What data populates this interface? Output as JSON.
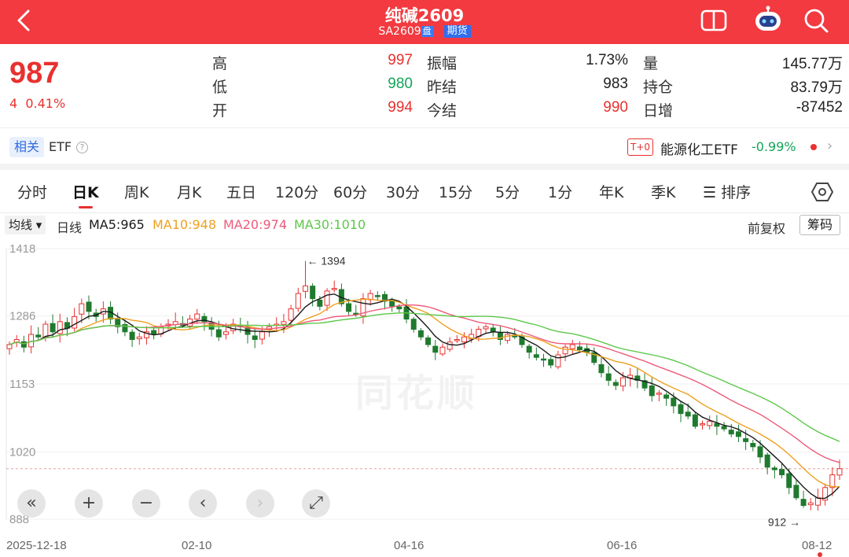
{
  "header": {
    "title": "纯碱2609",
    "code": "SA2609",
    "tag1": "盘",
    "tag2": "期货"
  },
  "quote": {
    "price": "987",
    "change": "4",
    "change_pct": "0.41%",
    "fields": [
      {
        "label": "高",
        "value": "997",
        "color": "red"
      },
      {
        "label": "低",
        "value": "980",
        "color": "green"
      },
      {
        "label": "开",
        "value": "994",
        "color": "red"
      },
      {
        "label": "振幅",
        "value": "1.73%",
        "color": "dark"
      },
      {
        "label": "昨结",
        "value": "983",
        "color": "dark"
      },
      {
        "label": "今结",
        "value": "990",
        "color": "red"
      },
      {
        "label": "量",
        "value": "145.77万",
        "color": "dark"
      },
      {
        "label": "持仓",
        "value": "83.79万",
        "color": "dark"
      },
      {
        "label": "日增",
        "value": "-87452",
        "color": "dark"
      }
    ]
  },
  "related": {
    "badge": "相关",
    "etf_label": "ETF",
    "help": "?",
    "t0": "T+0",
    "etf_name": "能源化工ETF",
    "etf_pct": "-0.99%",
    "arrow": "›"
  },
  "tabs": [
    "分时",
    "日K",
    "周K",
    "月K",
    "五日",
    "120分",
    "60分",
    "30分",
    "15分",
    "5分",
    "1分",
    "年K",
    "季K",
    "☰ 排序"
  ],
  "active_tab": "日K",
  "legend": {
    "selector": "均线 ▾",
    "period": "日线",
    "ma5": "MA5:965",
    "ma10": "MA10:948",
    "ma20": "MA20:974",
    "ma30": "MA30:1010",
    "adjust": "前复权",
    "chips": "筹码"
  },
  "colors": {
    "up": "#e8312f",
    "down": "#1f7a2e",
    "ma5": "#1a1a1a",
    "ma10": "#eea020",
    "ma20": "#ee5a7a",
    "ma30": "#5cc84a"
  },
  "watermark": "同花顺",
  "chart_data": {
    "type": "candlestick",
    "y_ticks": [
      1418,
      1286,
      1153,
      1020,
      888
    ],
    "ylim": [
      888,
      1418
    ],
    "x_ticks": [
      "2025-12-18",
      "02-10",
      "04-16",
      "06-16",
      "08-12"
    ],
    "max_label": "1394",
    "min_label": "912",
    "last_close": 987,
    "closes": [
      1230,
      1240,
      1225,
      1250,
      1245,
      1270,
      1255,
      1275,
      1262,
      1285,
      1310,
      1295,
      1285,
      1300,
      1280,
      1265,
      1255,
      1240,
      1245,
      1255,
      1250,
      1265,
      1270,
      1275,
      1268,
      1280,
      1290,
      1275,
      1260,
      1245,
      1255,
      1270,
      1265,
      1250,
      1240,
      1255,
      1265,
      1270,
      1275,
      1300,
      1330,
      1345,
      1320,
      1305,
      1335,
      1340,
      1310,
      1295,
      1290,
      1320,
      1330,
      1325,
      1315,
      1305,
      1300,
      1280,
      1260,
      1245,
      1230,
      1215,
      1225,
      1235,
      1240,
      1245,
      1250,
      1260,
      1265,
      1255,
      1240,
      1250,
      1245,
      1230,
      1215,
      1205,
      1200,
      1190,
      1210,
      1225,
      1230,
      1220,
      1215,
      1195,
      1175,
      1160,
      1150,
      1165,
      1170,
      1160,
      1145,
      1130,
      1135,
      1125,
      1110,
      1095,
      1090,
      1070,
      1075,
      1080,
      1070,
      1065,
      1055,
      1050,
      1040,
      1030,
      1010,
      990,
      985,
      975,
      950,
      930,
      915,
      920,
      930,
      950,
      975,
      987
    ]
  },
  "chart_buttons": [
    "«",
    "+",
    "−",
    "‹",
    "›",
    "⤢"
  ]
}
